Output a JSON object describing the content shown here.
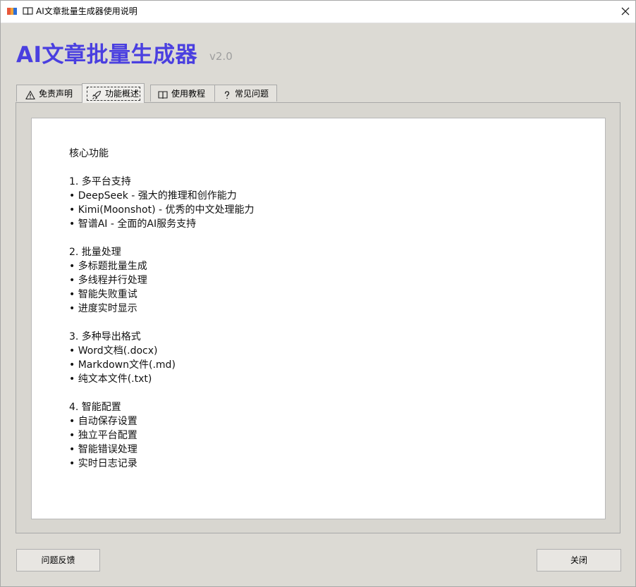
{
  "window": {
    "title": "AI文章批量生成器使用说明",
    "app_icon": "app-logo-icon",
    "title_icon": "book-icon"
  },
  "header": {
    "app_name": "AI文章批量生成器",
    "version": "v2.0"
  },
  "tabs": [
    {
      "label": "免责声明",
      "icon": "warning-icon",
      "active": false
    },
    {
      "label": "功能概述",
      "icon": "rocket-icon",
      "active": true
    },
    {
      "label": "使用教程",
      "icon": "book-icon",
      "active": false
    },
    {
      "label": "常见问题",
      "icon": "question-icon",
      "active": false
    }
  ],
  "content": {
    "lines": [
      "核心功能",
      "",
      "1. 多平台支持",
      "• DeepSeek - 强大的推理和创作能力",
      "• Kimi(Moonshot) - 优秀的中文处理能力",
      "• 智谱AI - 全面的AI服务支持",
      "",
      "2. 批量处理",
      "• 多标题批量生成",
      "• 多线程并行处理",
      "• 智能失败重试",
      "• 进度实时显示",
      "",
      "3. 多种导出格式",
      "• Word文档(.docx)",
      "• Markdown文件(.md)",
      "• 纯文本文件(.txt)",
      "",
      "4. 智能配置",
      "• 自动保存设置",
      "• 独立平台配置",
      "• 智能错误处理",
      "• 实时日志记录"
    ]
  },
  "footer": {
    "feedback_label": "问题反馈",
    "close_label": "关闭"
  },
  "colors": {
    "accent": "#4a3fe0",
    "version": "#9e9e9e",
    "background": "#dcdad4"
  }
}
